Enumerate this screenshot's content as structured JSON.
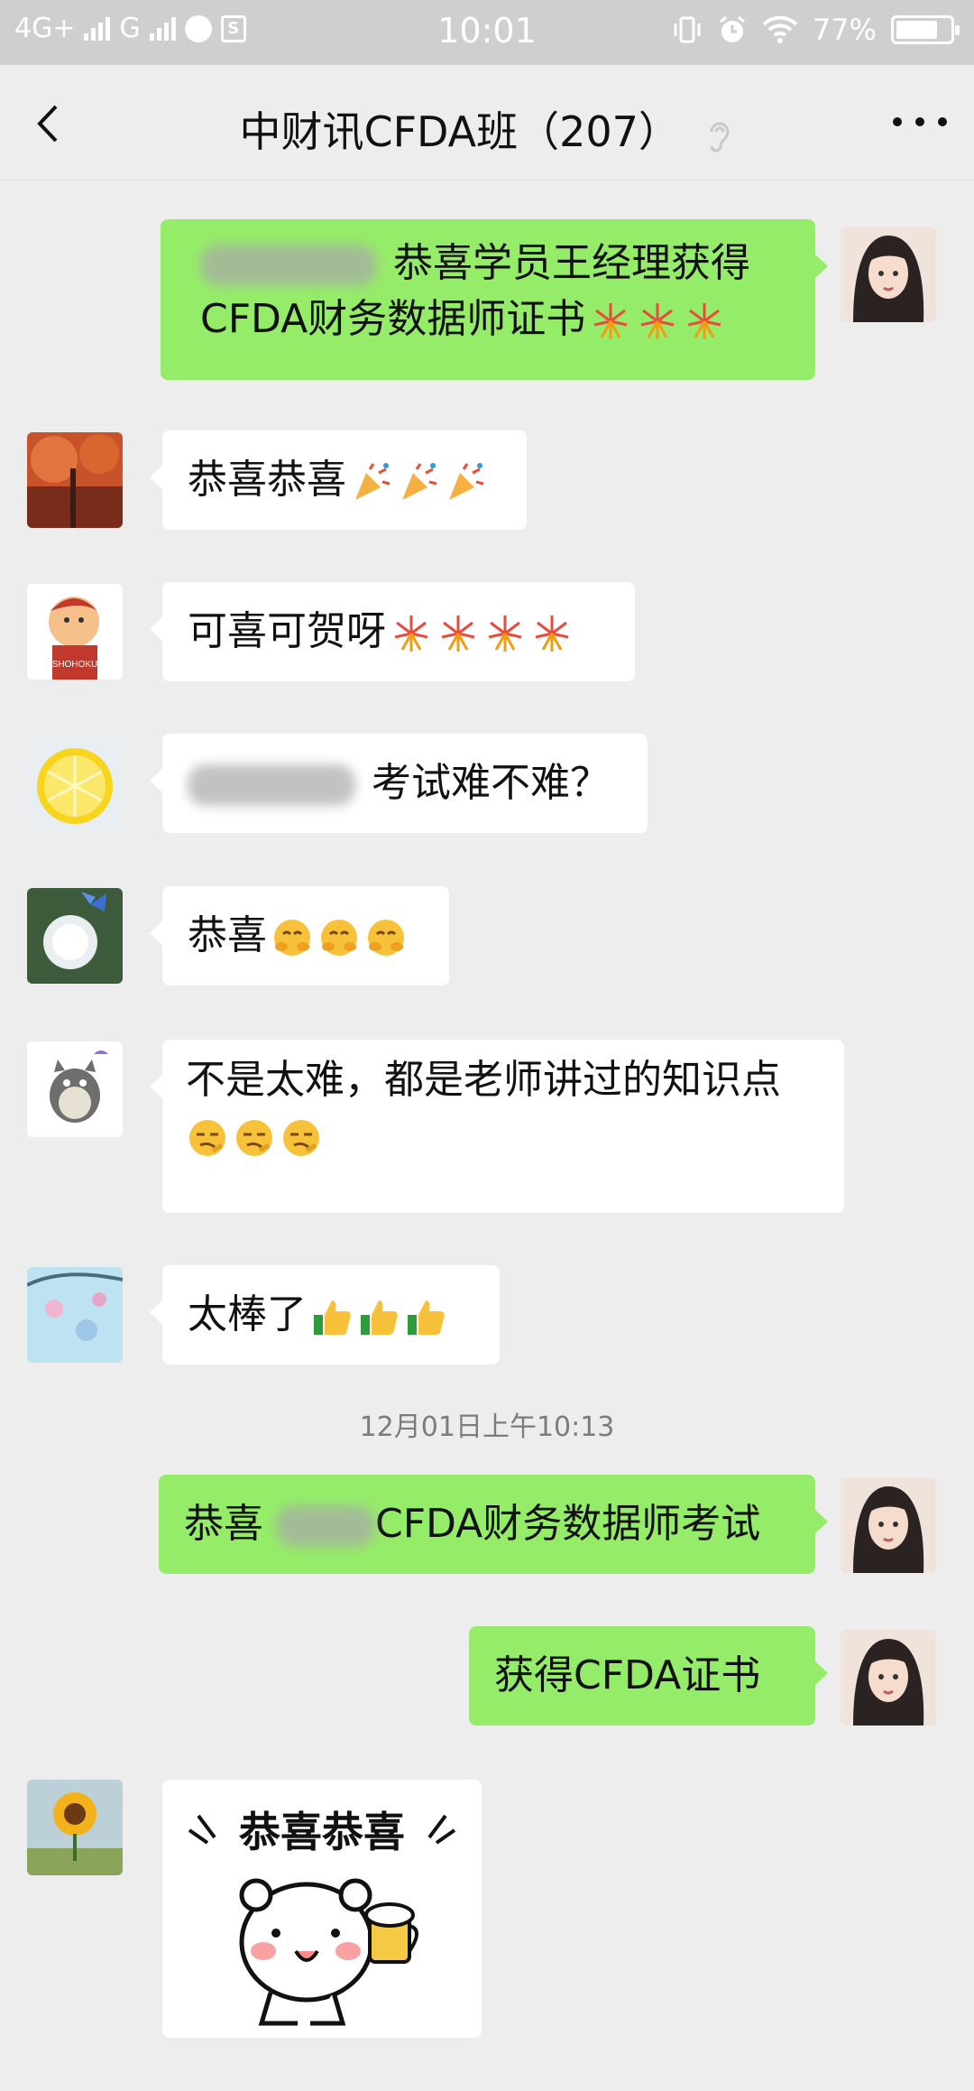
{
  "status_bar": {
    "network": "4G+",
    "network2": "G",
    "time": "10:01",
    "battery": "77%",
    "battery_level": 0.77
  },
  "nav": {
    "title": "中财讯CFDA班（207）",
    "back_icon": "chevron-left-icon",
    "more_icon": "more-dots-icon"
  },
  "messages": [
    {
      "side": "out",
      "line1": "恭喜学员王经理获得",
      "line2": "CFDA财务数据师证书"
    },
    {
      "side": "in",
      "text": "恭喜恭喜"
    },
    {
      "side": "in",
      "text": "可喜可贺呀"
    },
    {
      "side": "in",
      "text": "考试难不难？"
    },
    {
      "side": "in",
      "text": "恭喜"
    },
    {
      "side": "in",
      "text": "不是太难，都是老师讲过的知识点"
    },
    {
      "side": "in",
      "text": "太棒了"
    },
    {
      "side": "out",
      "pre": "恭喜",
      "text": "CFDA财务数据师考试"
    },
    {
      "side": "out",
      "text": "获得CFDA证书"
    },
    {
      "side": "in",
      "sticker_text": "恭喜恭喜"
    }
  ],
  "timestamp": "12月01日上午10:13",
  "colors": {
    "background": "#ededed",
    "out_bubble": "#95ec69",
    "in_bubble": "#ffffff",
    "status_bar": "#cfcfcf"
  }
}
